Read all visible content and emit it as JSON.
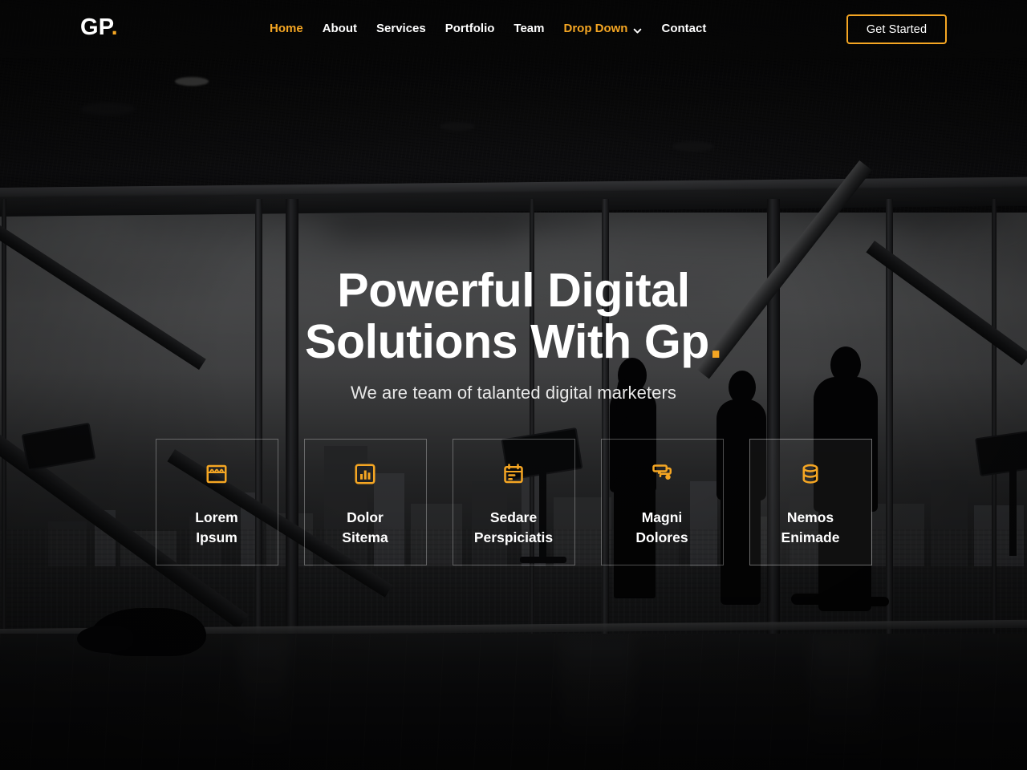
{
  "header": {
    "logo_text": "GP",
    "logo_dot": ".",
    "nav": [
      {
        "label": "Home",
        "active": true,
        "dropdown": false
      },
      {
        "label": "About",
        "active": false,
        "dropdown": false
      },
      {
        "label": "Services",
        "active": false,
        "dropdown": false
      },
      {
        "label": "Portfolio",
        "active": false,
        "dropdown": false
      },
      {
        "label": "Team",
        "active": false,
        "dropdown": false
      },
      {
        "label": "Drop Down",
        "active": false,
        "dropdown": true
      },
      {
        "label": "Contact",
        "active": false,
        "dropdown": false
      }
    ],
    "cta_label": "Get Started"
  },
  "hero": {
    "title_line1": "Powerful Digital",
    "title_line2": "Solutions With Gp",
    "title_dot": ".",
    "subtitle": "We are team of talanted digital marketers"
  },
  "feature_boxes": [
    {
      "icon": "store-icon",
      "line1": "Lorem",
      "line2": "Ipsum",
      "active": false
    },
    {
      "icon": "bar-chart-icon",
      "line1": "Dolor",
      "line2": "Sitema",
      "active": false
    },
    {
      "icon": "calendar-icon",
      "line1": "Sedare",
      "line2": "Perspiciatis",
      "active": false
    },
    {
      "icon": "paint-roller-icon",
      "line1": "Magni",
      "line2": "Dolores",
      "active": false
    },
    {
      "icon": "database-icon",
      "line1": "Nemos",
      "line2": "Enimade",
      "active": true
    }
  ],
  "colors": {
    "accent": "#f5a623",
    "text_primary": "#ffffff",
    "text_secondary": "#e8e8e8",
    "header_bg": "rgba(8,8,8,0.55)",
    "box_border": "rgba(255,255,255,0.30)"
  }
}
